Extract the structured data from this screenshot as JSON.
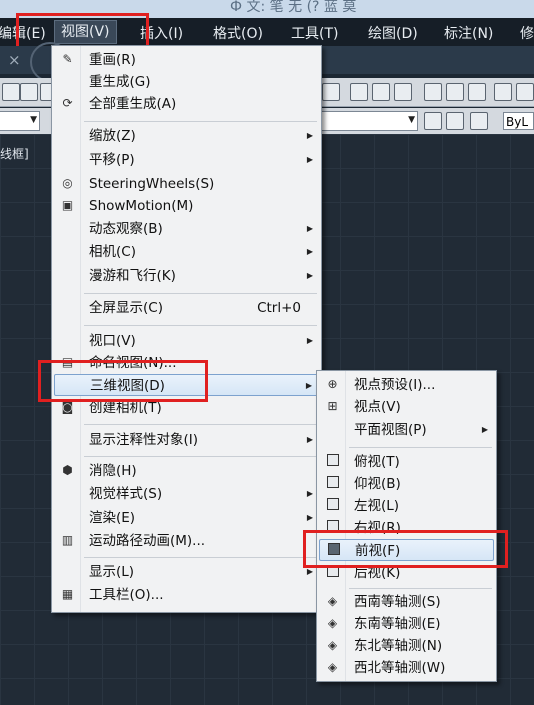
{
  "titlebar": {
    "text": "Ф 文: 笔 无 (? 蓝 莫"
  },
  "menubar": [
    {
      "label": "编辑(E)"
    },
    {
      "label": "视图(V)"
    },
    {
      "label": "插入(I)"
    },
    {
      "label": "格式(O)"
    },
    {
      "label": "工具(T)"
    },
    {
      "label": "绘图(D)"
    },
    {
      "label": "标注(N)"
    },
    {
      "label": "修"
    }
  ],
  "tab": {
    "close": "×"
  },
  "canvas": {
    "viewport_label": "线框]"
  },
  "toolbar": {
    "bylayer": "ByL"
  },
  "view_menu": {
    "items": [
      {
        "label": "重画(R)",
        "icon": "pencil-icon"
      },
      {
        "label": "重生成(G)"
      },
      {
        "label": "全部重生成(A)",
        "icon": "regen-all-icon"
      },
      {
        "label": "缩放(Z)"
      },
      {
        "label": "平移(P)"
      },
      {
        "label": "SteeringWheels(S)",
        "icon": "steering-wheel-icon"
      },
      {
        "label": "ShowMotion(M)",
        "icon": "showmotion-icon"
      },
      {
        "label": "动态观察(B)"
      },
      {
        "label": "相机(C)"
      },
      {
        "label": "漫游和飞行(K)"
      },
      {
        "label": "全屏显示(C)",
        "shortcut": "Ctrl+0"
      },
      {
        "label": "视口(V)"
      },
      {
        "label": "命名视图(N)..."
      },
      {
        "label": "三维视图(D)"
      },
      {
        "label": "创建相机(T)",
        "icon": "camera-icon"
      },
      {
        "label": "显示注释性对象(I)"
      },
      {
        "label": "消隐(H)",
        "icon": "hide-icon"
      },
      {
        "label": "视觉样式(S)"
      },
      {
        "label": "渲染(E)"
      },
      {
        "label": "运动路径动画(M)...",
        "icon": "motion-path-icon"
      },
      {
        "label": "显示(L)"
      },
      {
        "label": "工具栏(O)...",
        "icon": "toolbar-icon"
      }
    ]
  },
  "view3d_menu": {
    "items": [
      {
        "label": "视点预设(I)..."
      },
      {
        "label": "视点(V)"
      },
      {
        "label": "平面视图(P)"
      },
      {
        "label": "俯视(T)"
      },
      {
        "label": "仰视(B)"
      },
      {
        "label": "左视(L)"
      },
      {
        "label": "右视(R)"
      },
      {
        "label": "前视(F)"
      },
      {
        "label": "后视(K)"
      },
      {
        "label": "西南等轴测(S)"
      },
      {
        "label": "东南等轴测(E)"
      },
      {
        "label": "东北等轴测(N)"
      },
      {
        "label": "西北等轴测(W)"
      }
    ]
  },
  "glyphs": {
    "arrow": "▶"
  }
}
